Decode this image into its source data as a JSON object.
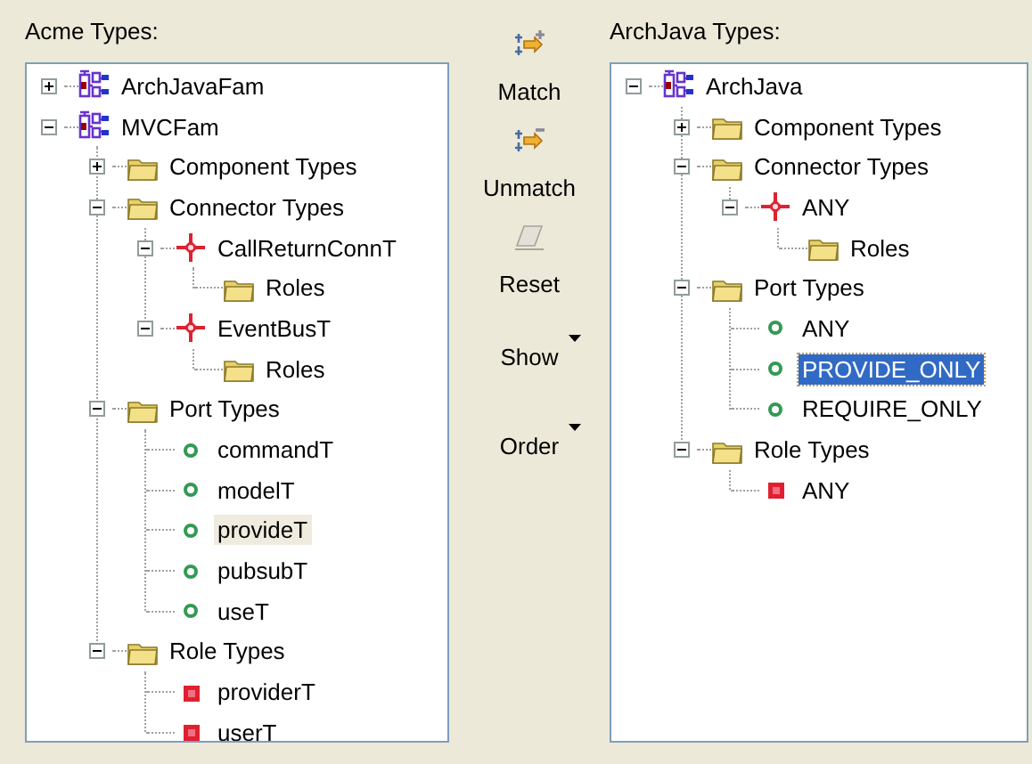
{
  "acme_panel": {
    "label": "Acme Types:",
    "focused": false,
    "tree": [
      {
        "label": "ArchJavaFam",
        "kind": "family",
        "expanded": false,
        "selected": false
      },
      {
        "label": "MVCFam",
        "kind": "family",
        "expanded": true,
        "selected": false,
        "children": [
          {
            "label": "Component Types",
            "kind": "folder",
            "expanded": false,
            "selected": false
          },
          {
            "label": "Connector Types",
            "kind": "folder",
            "expanded": true,
            "selected": false,
            "children": [
              {
                "label": "CallReturnConnT",
                "kind": "connector",
                "expanded": true,
                "selected": false,
                "children": [
                  {
                    "label": "Roles",
                    "kind": "folder",
                    "selected": false
                  }
                ]
              },
              {
                "label": "EventBusT",
                "kind": "connector",
                "expanded": true,
                "selected": false,
                "children": [
                  {
                    "label": "Roles",
                    "kind": "folder",
                    "selected": false
                  }
                ]
              }
            ]
          },
          {
            "label": "Port Types",
            "kind": "folder",
            "expanded": true,
            "selected": false,
            "children": [
              {
                "label": "commandT",
                "kind": "port",
                "selected": false
              },
              {
                "label": "modelT",
                "kind": "port",
                "selected": false
              },
              {
                "label": "provideT",
                "kind": "port",
                "selected": true
              },
              {
                "label": "pubsubT",
                "kind": "port",
                "selected": false
              },
              {
                "label": "useT",
                "kind": "port",
                "selected": false
              }
            ]
          },
          {
            "label": "Role Types",
            "kind": "folder",
            "expanded": true,
            "selected": false,
            "children": [
              {
                "label": "providerT",
                "kind": "role",
                "selected": false
              },
              {
                "label": "userT",
                "kind": "role",
                "selected": false
              }
            ]
          }
        ]
      }
    ]
  },
  "actions": [
    {
      "label": "Match",
      "kind": "match"
    },
    {
      "label": "Unmatch",
      "kind": "unmatch"
    },
    {
      "label": "Reset",
      "kind": "reset"
    },
    {
      "label": "Show",
      "kind": "menu"
    },
    {
      "label": "Order",
      "kind": "menu"
    }
  ],
  "archjava_panel": {
    "label": "ArchJava Types:",
    "focused": true,
    "tree": [
      {
        "label": "ArchJava",
        "kind": "family",
        "expanded": true,
        "selected": false,
        "children": [
          {
            "label": "Component Types",
            "kind": "folder",
            "expanded": false,
            "selected": false
          },
          {
            "label": "Connector Types",
            "kind": "folder",
            "expanded": true,
            "selected": false,
            "children": [
              {
                "label": "ANY",
                "kind": "connector",
                "expanded": true,
                "selected": false,
                "children": [
                  {
                    "label": "Roles",
                    "kind": "folder",
                    "selected": false
                  }
                ]
              }
            ]
          },
          {
            "label": "Port Types",
            "kind": "folder",
            "expanded": true,
            "selected": false,
            "children": [
              {
                "label": "ANY",
                "kind": "port",
                "selected": false
              },
              {
                "label": "PROVIDE_ONLY",
                "kind": "port",
                "selected": true
              },
              {
                "label": "REQUIRE_ONLY",
                "kind": "port",
                "selected": false
              }
            ]
          },
          {
            "label": "Role Types",
            "kind": "folder",
            "expanded": true,
            "selected": false,
            "children": [
              {
                "label": "ANY",
                "kind": "role",
                "selected": false
              }
            ]
          }
        ]
      }
    ]
  }
}
